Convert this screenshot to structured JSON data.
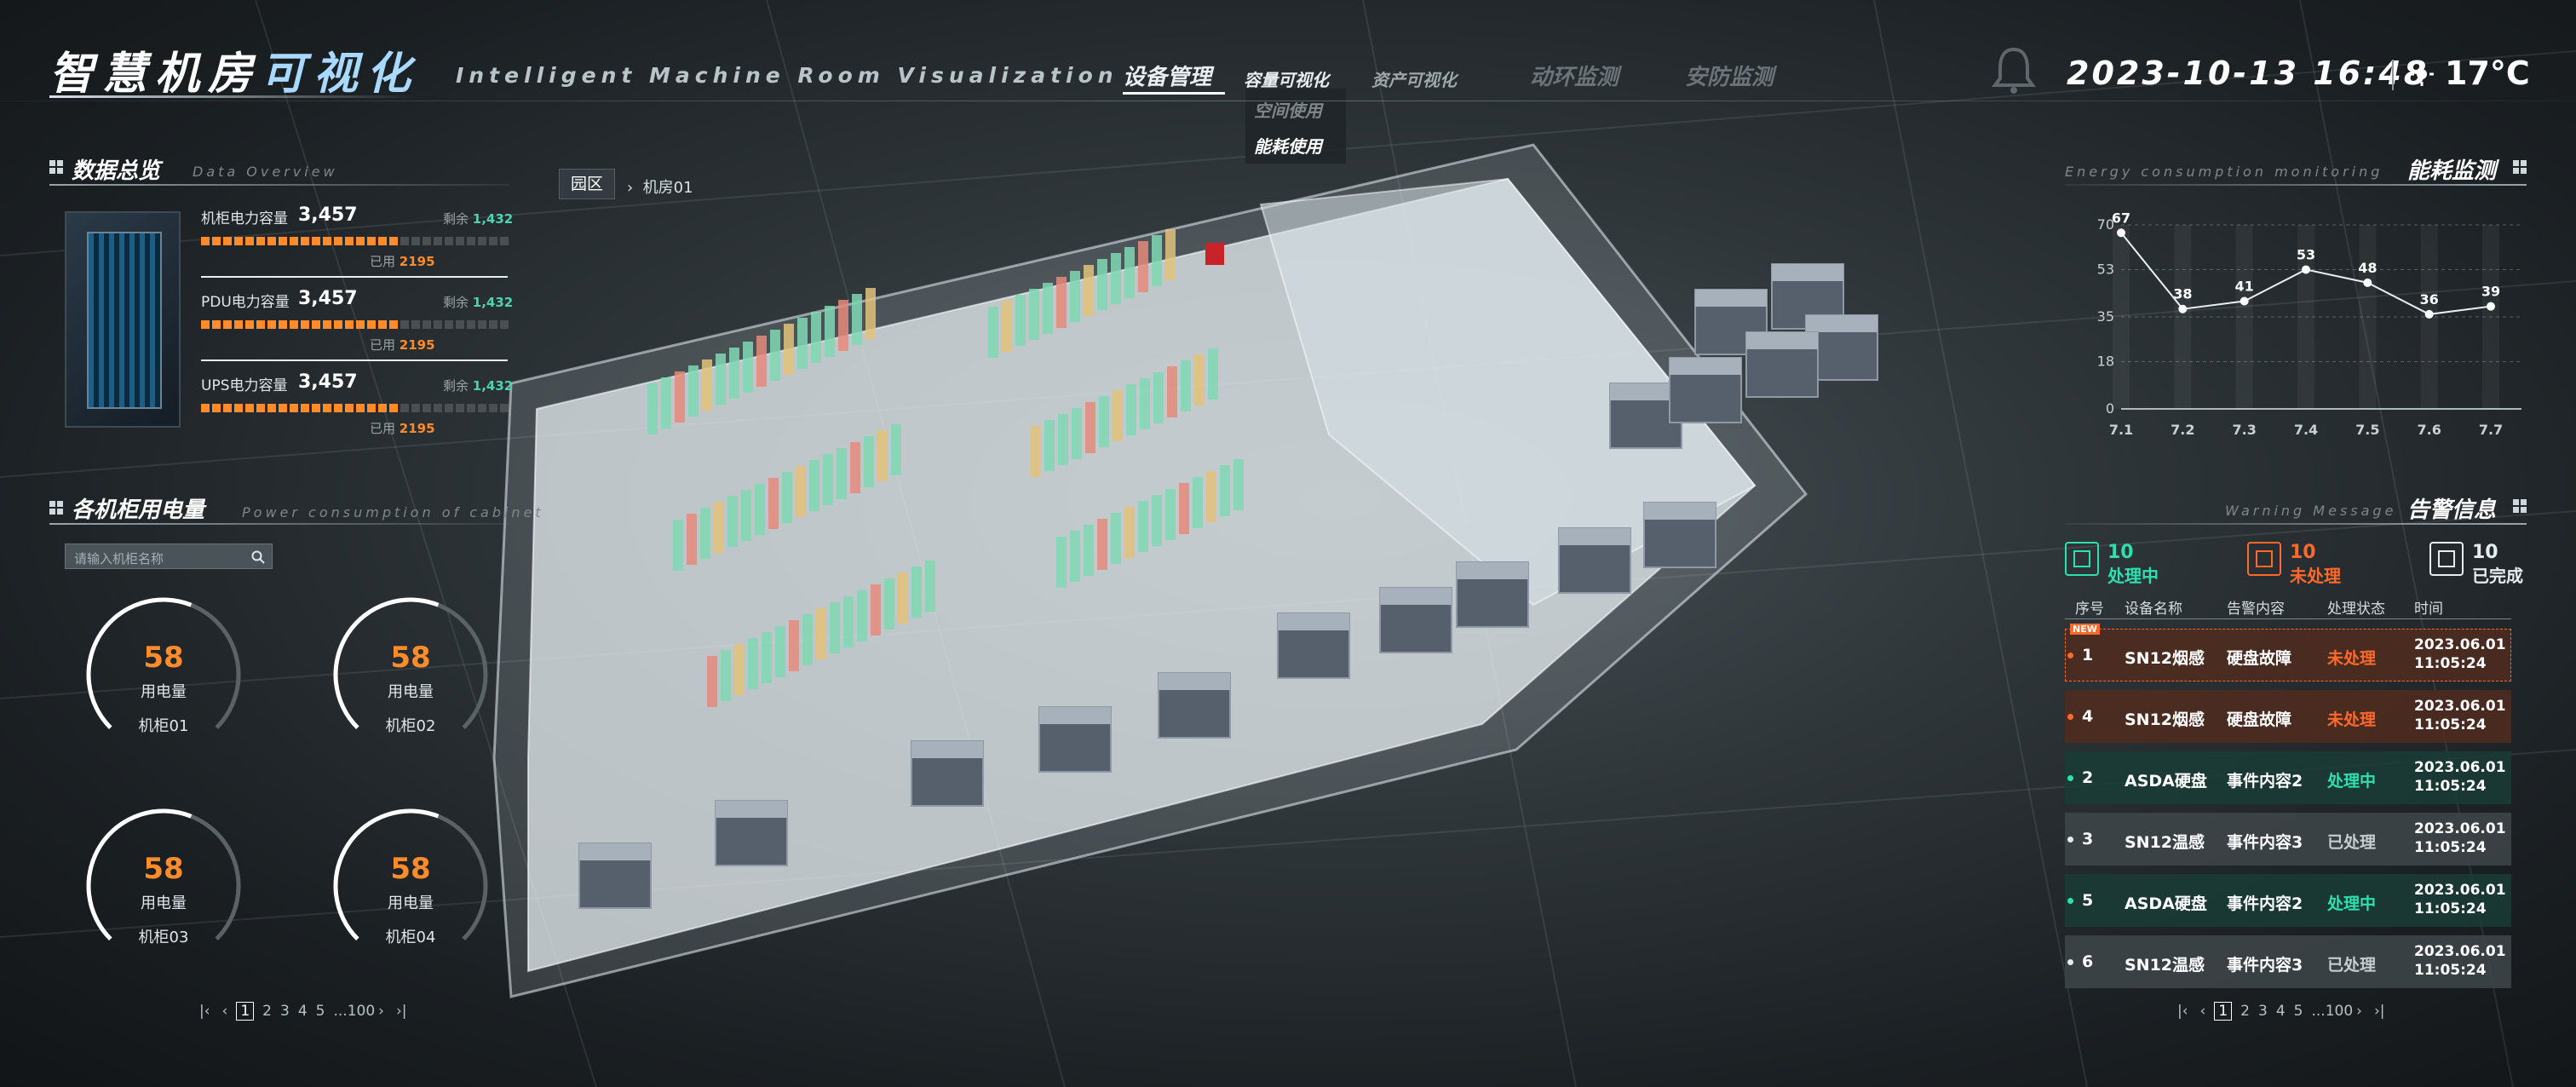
{
  "header": {
    "title_a": "智慧机房",
    "title_b": "可视化",
    "subtitle": "Intelligent Machine Room Visualization",
    "nav": [
      "设备管理",
      "容量可视化",
      "资产可视化",
      "动环监测",
      "安防监测"
    ],
    "dropdown": [
      "空间使用",
      "能耗使用"
    ],
    "datetime": "2023-10-13  16:48",
    "temperature": "17°C",
    "icons": [
      "bell-icon",
      "sun-icon"
    ]
  },
  "overview": {
    "title": "数据总览",
    "subtitle": "Data Overview",
    "items": [
      {
        "label": "机柜电力容量",
        "value": "3,457",
        "remain_label": "剩余",
        "remain": "1,432",
        "used_label": "已用",
        "used": "2195",
        "fill": 0.64
      },
      {
        "label": "PDU电力容量",
        "value": "3,457",
        "remain_label": "剩余",
        "remain": "1,432",
        "used_label": "已用",
        "used": "2195",
        "fill": 0.64
      },
      {
        "label": "UPS电力容量",
        "value": "3,457",
        "remain_label": "剩余",
        "remain": "1,432",
        "used_label": "已用",
        "used": "2195",
        "fill": 0.64
      }
    ]
  },
  "cabinets": {
    "title": "各机柜用电量",
    "subtitle": "Power consumption of cabinet",
    "search_placeholder": "请输入机柜名称",
    "gauges": [
      {
        "value": "58",
        "label": "用电量",
        "name": "机柜01",
        "fill": 0.58
      },
      {
        "value": "58",
        "label": "用电量",
        "name": "机柜02",
        "fill": 0.58
      },
      {
        "value": "58",
        "label": "用电量",
        "name": "机柜03",
        "fill": 0.58
      },
      {
        "value": "58",
        "label": "用电量",
        "name": "机柜04",
        "fill": 0.58
      }
    ]
  },
  "pager": {
    "first": "|‹",
    "prev": "‹",
    "pages": [
      "1",
      "2",
      "3",
      "4",
      "5"
    ],
    "ellipsis": "...100",
    "next": "›",
    "last": "›|"
  },
  "breadcrumb": {
    "root": "园区",
    "sep": "›",
    "current": "机房01"
  },
  "energy": {
    "title": "能耗监测",
    "subtitle": "Energy consumption monitoring"
  },
  "chart_data": {
    "type": "line",
    "title": "能耗监测",
    "x": [
      "7.1",
      "7.2",
      "7.3",
      "7.4",
      "7.5",
      "7.6",
      "7.7"
    ],
    "series": [
      {
        "values": [
          67,
          38,
          41,
          53,
          48,
          36,
          39
        ]
      }
    ],
    "yticks": [
      "0",
      "18",
      "35",
      "53",
      "70"
    ],
    "ylim": [
      0,
      70
    ],
    "grid": true,
    "legend": "none"
  },
  "warning": {
    "title": "告警信息",
    "subtitle": "Warning Message",
    "stats": [
      {
        "count": "10",
        "label": "处理中",
        "color": "#2ee0b0",
        "icon": "processing-icon"
      },
      {
        "count": "10",
        "label": "未处理",
        "color": "#ff6a2b",
        "icon": "unprocessed-icon"
      },
      {
        "count": "10",
        "label": "已完成",
        "color": "#e6edf0",
        "icon": "completed-icon"
      }
    ],
    "columns": [
      "序号",
      "设备名称",
      "告警内容",
      "处理状态",
      "时间"
    ],
    "new_badge": "NEW",
    "rows": [
      {
        "no": "1",
        "device": "SN12烟感",
        "content": "硬盘故障",
        "status": "未处理",
        "state": "red",
        "date": "2023.06.01",
        "time": "11:05:24"
      },
      {
        "no": "4",
        "device": "SN12烟感",
        "content": "硬盘故障",
        "status": "未处理",
        "state": "red",
        "date": "2023.06.01",
        "time": "11:05:24"
      },
      {
        "no": "2",
        "device": "ASDA硬盘",
        "content": "事件内容2",
        "status": "处理中",
        "state": "green",
        "date": "2023.06.01",
        "time": "11:05:24"
      },
      {
        "no": "3",
        "device": "SN12温感",
        "content": "事件内容3",
        "status": "已处理",
        "state": "grey",
        "date": "2023.06.01",
        "time": "11:05:24"
      },
      {
        "no": "5",
        "device": "ASDA硬盘",
        "content": "事件内容2",
        "status": "处理中",
        "state": "green",
        "date": "2023.06.01",
        "time": "11:05:24"
      },
      {
        "no": "6",
        "device": "SN12温感",
        "content": "事件内容3",
        "status": "已处理",
        "state": "grey",
        "date": "2023.06.01",
        "time": "11:05:24"
      }
    ]
  },
  "colors": {
    "accent_orange": "#ff8b2b",
    "accent_green": "#2ee0b0",
    "accent_red": "#ff6a2b",
    "rack_green": "#7fd8b4",
    "rack_red": "#e58a7a",
    "rack_yellow": "#e2c27a"
  }
}
